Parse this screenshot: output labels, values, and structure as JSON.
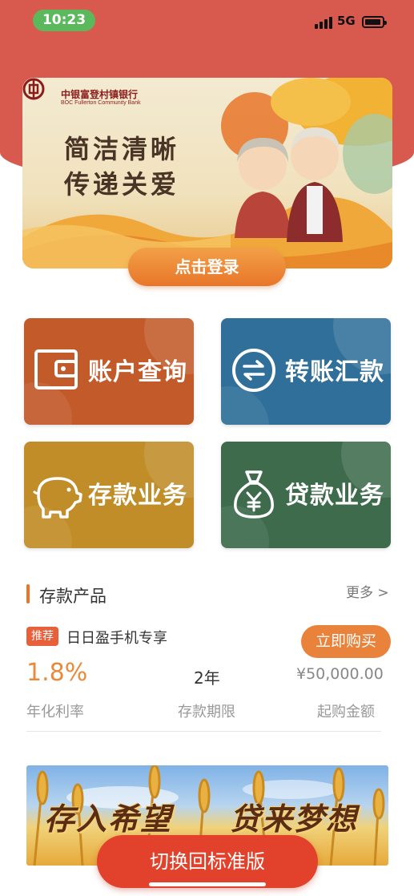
{
  "status_bar": {
    "time": "10:23",
    "network": "5G",
    "signal_icon": "signal-bars-icon",
    "battery_icon": "battery-icon"
  },
  "hero": {
    "bank_name_cn": "中银富登村镇银行",
    "bank_name_en": "BOC Fullerton Community Bank",
    "slogan_line1": "简洁清晰",
    "slogan_line2": "传递关爱",
    "login_button": "点击登录"
  },
  "tiles": [
    {
      "label": "账户查询",
      "icon": "wallet-icon",
      "color": "#c25a2a"
    },
    {
      "label": "转账汇款",
      "icon": "transfer-arrows-icon",
      "color": "#2f6f9a"
    },
    {
      "label": "存款业务",
      "icon": "piggy-bank-icon",
      "color": "#c08d28"
    },
    {
      "label": "贷款业务",
      "icon": "money-bag-icon",
      "color": "#3d6b4c"
    }
  ],
  "deposit_section": {
    "title": "存款产品",
    "more": "更多 >",
    "product": {
      "badge": "推荐",
      "name": "日日盈手机专享",
      "buy_button": "立即购买",
      "rate": "1.8%",
      "term": "2年",
      "min_amount": "¥50,000.00",
      "rate_label": "年化利率",
      "term_label": "存款期限",
      "amount_label": "起购金额"
    }
  },
  "banner2": {
    "text_left": "存入希望",
    "text_right": "贷来梦想"
  },
  "switch_button": "切换回标准版",
  "colors": {
    "header_red": "#d85a4f",
    "accent_orange": "#e8762a",
    "switch_red": "#e2422b"
  }
}
